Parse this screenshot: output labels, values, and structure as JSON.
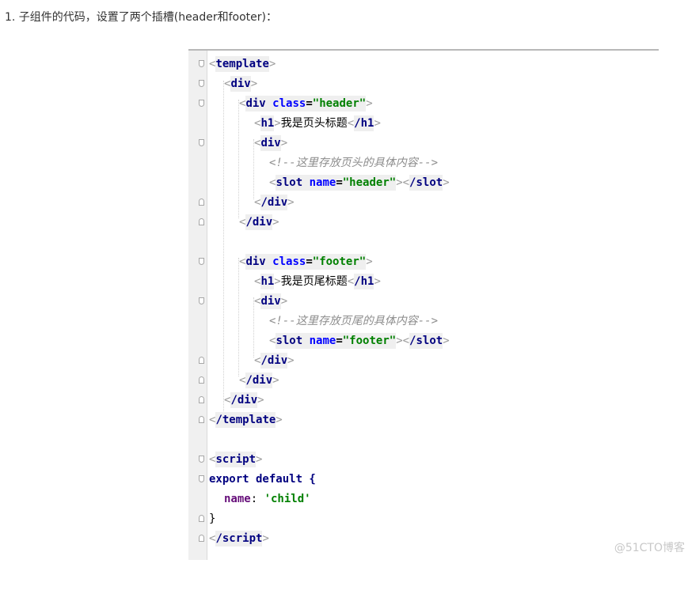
{
  "intro_text": "1. 子组件的代码，设置了两个插槽(header和footer)：",
  "code": {
    "l1_tag": "template",
    "l2_tag": "div",
    "l3_tag": "div",
    "l3_attr": "class",
    "l3_val": "\"header\"",
    "l4_tag_open": "h1",
    "l4_text": "我是页头标题",
    "l4_tag_close": "/h1",
    "l5_tag": "div",
    "l6_comment": "<!--这里存放页头的具体内容-->",
    "l7_tag_open": "slot",
    "l7_attr": "name",
    "l7_val": "\"header\"",
    "l7_tag_close": "/slot",
    "l8_tag": "/div",
    "l9_tag": "/div",
    "l11_tag": "div",
    "l11_attr": "class",
    "l11_val": "\"footer\"",
    "l12_tag_open": "h1",
    "l12_text": "我是页尾标题",
    "l12_tag_close": "/h1",
    "l13_tag": "div",
    "l14_comment": "<!--这里存放页尾的具体内容-->",
    "l15_tag_open": "slot",
    "l15_attr": "name",
    "l15_val": "\"footer\"",
    "l15_tag_close": "/slot",
    "l16_tag": "/div",
    "l17_tag": "/div",
    "l18_tag": "/div",
    "l19_tag": "/template",
    "l21_tag": "script",
    "l22_text": "export default {",
    "l23_prop": "name",
    "l23_colon": ": ",
    "l23_val": "'child'",
    "l24_text": "}",
    "l25_tag": "/script"
  },
  "watermark": "@51CTO博客"
}
